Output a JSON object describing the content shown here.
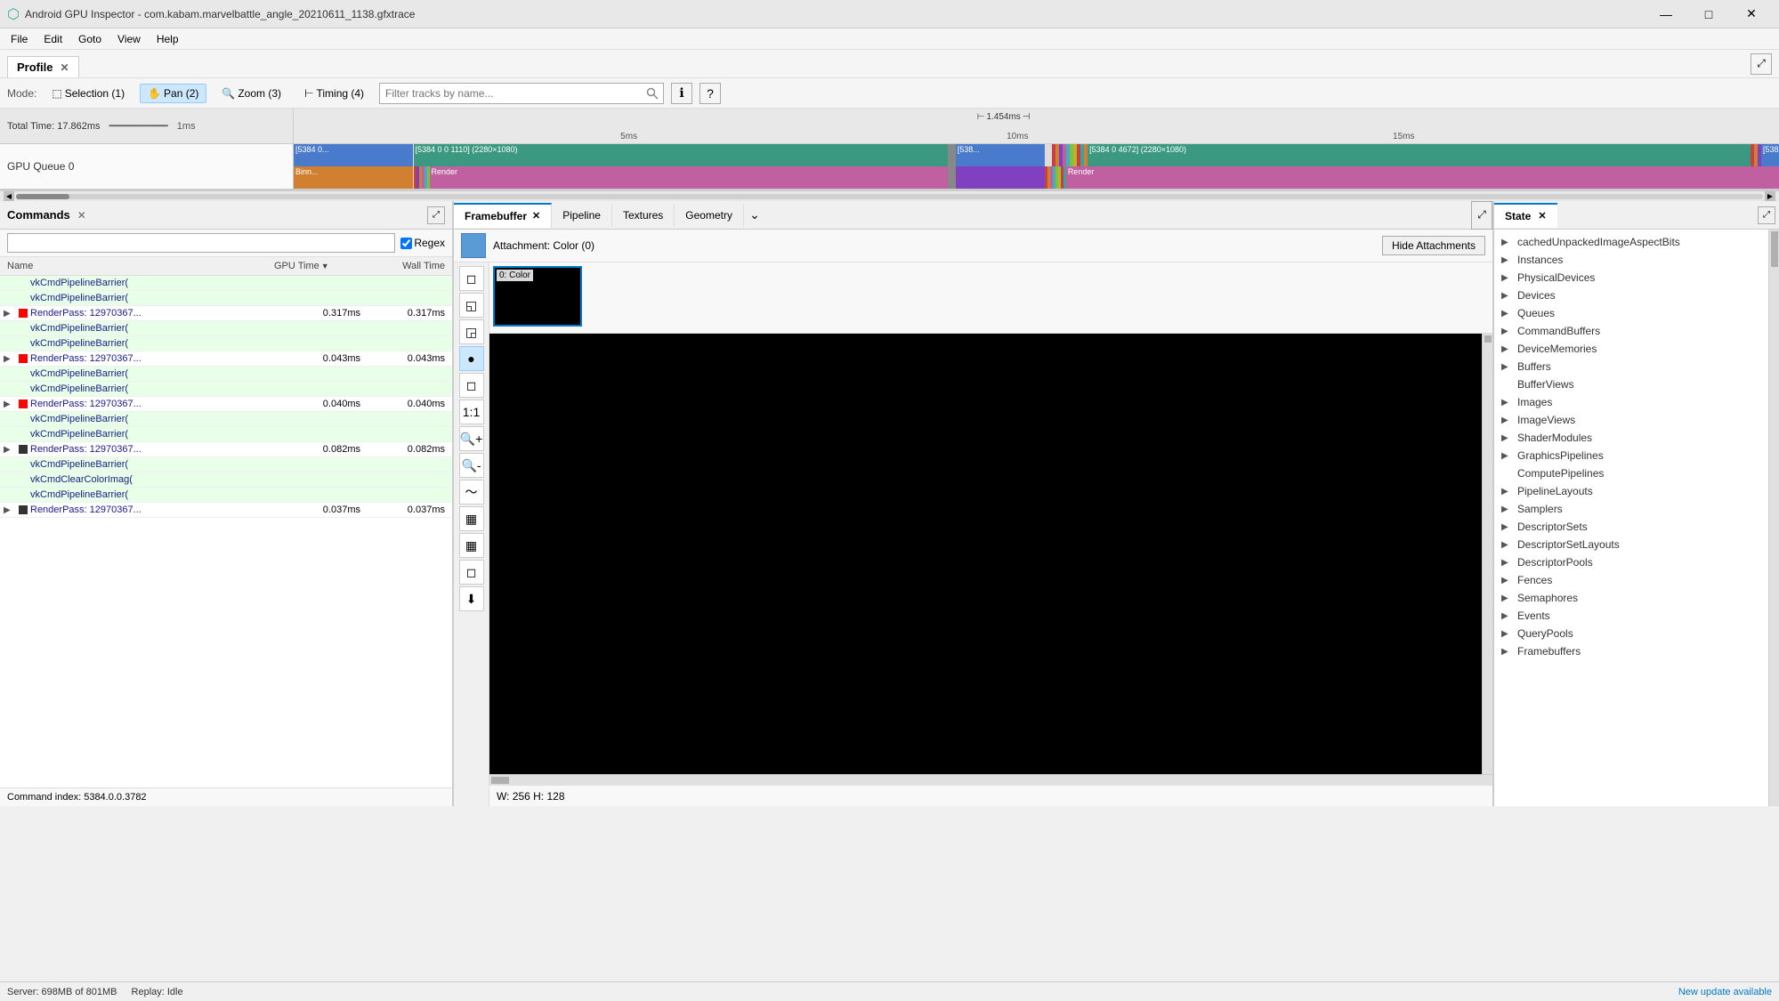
{
  "app": {
    "title": "Android GPU Inspector - com.kabam.marvelbattle_angle_20210611_1138.gfxtrace",
    "icon": "●"
  },
  "titlebar": {
    "minimize": "—",
    "maximize": "□",
    "close": "✕"
  },
  "menubar": {
    "items": [
      "File",
      "Edit",
      "Goto",
      "View",
      "Help"
    ]
  },
  "profile_tab": {
    "label": "Profile",
    "close": "✕"
  },
  "mode_toolbar": {
    "mode_label": "Mode:",
    "modes": [
      {
        "label": "Selection (1)",
        "icon": "⬚",
        "active": false
      },
      {
        "label": "Pan (2)",
        "icon": "✋",
        "active": true
      },
      {
        "label": "Zoom (3)",
        "icon": "🔍",
        "active": false
      },
      {
        "label": "Timing (4)",
        "icon": "⊢",
        "active": false
      }
    ],
    "filter_placeholder": "Filter tracks by name...",
    "info_btn": "ℹ",
    "help_btn": "?"
  },
  "timeline": {
    "total_time": "Total Time: 17.862ms",
    "scale": "1ms",
    "marks": [
      "5ms",
      "10ms",
      "15ms"
    ],
    "duration_indicator": "1.454ms",
    "duration_arrows": "⊢⊣"
  },
  "gpu_queue": {
    "label": "GPU Queue 0",
    "blocks_top": [
      {
        "text": "[5384 0...",
        "color": "blk-blue"
      },
      {
        "text": "[5384 0 0 1110] (2280×1080)",
        "color": "blk-teal"
      },
      {
        "text": "[538...",
        "color": "blk-blue"
      },
      {
        "text": "[5384 0 4672] (2280×1080)",
        "color": "blk-teal"
      },
      {
        "text": "[538...",
        "color": "blk-blue"
      }
    ],
    "blocks_bottom": [
      {
        "text": "Binn...",
        "color": "blk-orange"
      },
      {
        "text": "",
        "color": "blk-red"
      },
      {
        "text": "Render",
        "color": "blk-pink"
      },
      {
        "text": "",
        "color": "blk-red"
      },
      {
        "text": "Render",
        "color": "blk-pink"
      }
    ]
  },
  "commands_panel": {
    "title": "Commands",
    "close": "✕",
    "search_placeholder": "",
    "regex_label": "Regex",
    "columns": {
      "name": "Name",
      "gpu_time": "GPU Time",
      "wall_time": "Wall Time"
    },
    "rows": [
      {
        "indent": 1,
        "expand": false,
        "icon": "none",
        "name": "vkCmdPipelineBarrier(",
        "gpu_time": "",
        "wall_time": "",
        "green": true
      },
      {
        "indent": 1,
        "expand": false,
        "icon": "none",
        "name": "vkCmdPipelineBarrier(",
        "gpu_time": "",
        "wall_time": "",
        "green": true
      },
      {
        "indent": 1,
        "expand": true,
        "icon": "red",
        "name": "RenderPass: 12970367...",
        "gpu_time": "0.317ms",
        "wall_time": "0.317ms",
        "green": false
      },
      {
        "indent": 1,
        "expand": false,
        "icon": "none",
        "name": "vkCmdPipelineBarrier(",
        "gpu_time": "",
        "wall_time": "",
        "green": true
      },
      {
        "indent": 1,
        "expand": false,
        "icon": "none",
        "name": "vkCmdPipelineBarrier(",
        "gpu_time": "",
        "wall_time": "",
        "green": true
      },
      {
        "indent": 1,
        "expand": true,
        "icon": "red",
        "name": "RenderPass: 12970367...",
        "gpu_time": "0.043ms",
        "wall_time": "0.043ms",
        "green": false
      },
      {
        "indent": 1,
        "expand": false,
        "icon": "none",
        "name": "vkCmdPipelineBarrier(",
        "gpu_time": "",
        "wall_time": "",
        "green": true
      },
      {
        "indent": 1,
        "expand": false,
        "icon": "none",
        "name": "vkCmdPipelineBarrier(",
        "gpu_time": "",
        "wall_time": "",
        "green": true
      },
      {
        "indent": 1,
        "expand": true,
        "icon": "red",
        "name": "RenderPass: 12970367...",
        "gpu_time": "0.040ms",
        "wall_time": "0.040ms",
        "green": false
      },
      {
        "indent": 1,
        "expand": false,
        "icon": "none",
        "name": "vkCmdPipelineBarrier(",
        "gpu_time": "",
        "wall_time": "",
        "green": true
      },
      {
        "indent": 1,
        "expand": false,
        "icon": "none",
        "name": "vkCmdPipelineBarrier(",
        "gpu_time": "",
        "wall_time": "",
        "green": true
      },
      {
        "indent": 1,
        "expand": true,
        "icon": "dark",
        "name": "RenderPass: 12970367...",
        "gpu_time": "0.082ms",
        "wall_time": "0.082ms",
        "green": false
      },
      {
        "indent": 1,
        "expand": false,
        "icon": "none",
        "name": "vkCmdPipelineBarrier(",
        "gpu_time": "",
        "wall_time": "",
        "green": true
      },
      {
        "indent": 1,
        "expand": false,
        "icon": "none",
        "name": "vkCmdClearColorImag(",
        "gpu_time": "",
        "wall_time": "",
        "green": true
      },
      {
        "indent": 1,
        "expand": false,
        "icon": "none",
        "name": "vkCmdPipelineBarrier(",
        "gpu_time": "",
        "wall_time": "",
        "green": true
      },
      {
        "indent": 1,
        "expand": true,
        "icon": "dark",
        "name": "RenderPass: 12970367...",
        "gpu_time": "0.037ms",
        "wall_time": "0.037ms",
        "green": false
      }
    ],
    "command_index": "Command index: 5384.0.0.3782"
  },
  "framebuffer_panel": {
    "tabs": [
      "Framebuffer",
      "Pipeline",
      "Textures",
      "Geometry"
    ],
    "active_tab": "Framebuffer",
    "attachment_label": "Attachment: Color (0)",
    "hide_attachments_btn": "Hide Attachments",
    "tools": [
      "◻",
      "◱",
      "◲",
      "●",
      "◻2",
      "1:1",
      "🔍+",
      "🔍-",
      "〜",
      "▦",
      "▦2",
      "◻3",
      "⬇"
    ],
    "thumbnail": {
      "label": "0: Color",
      "bg": "#000"
    },
    "image_bg": "#000",
    "size_info": "W: 256 H: 128"
  },
  "state_panel": {
    "title": "State",
    "close": "✕",
    "items": [
      {
        "label": "cachedUnpackedImageAspectBits",
        "expandable": true
      },
      {
        "label": "Instances",
        "expandable": true
      },
      {
        "label": "PhysicalDevices",
        "expandable": true
      },
      {
        "label": "Devices",
        "expandable": true
      },
      {
        "label": "Queues",
        "expandable": true
      },
      {
        "label": "CommandBuffers",
        "expandable": true
      },
      {
        "label": "DeviceMemories",
        "expandable": true
      },
      {
        "label": "Buffers",
        "expandable": true
      },
      {
        "label": "BufferViews",
        "expandable": false
      },
      {
        "label": "Images",
        "expandable": true
      },
      {
        "label": "ImageViews",
        "expandable": true
      },
      {
        "label": "ShaderModules",
        "expandable": true
      },
      {
        "label": "GraphicsPipelines",
        "expandable": true
      },
      {
        "label": "ComputePipelines",
        "expandable": false
      },
      {
        "label": "PipelineLayouts",
        "expandable": true
      },
      {
        "label": "Samplers",
        "expandable": true
      },
      {
        "label": "DescriptorSets",
        "expandable": true
      },
      {
        "label": "DescriptorSetLayouts",
        "expandable": true
      },
      {
        "label": "DescriptorPools",
        "expandable": true
      },
      {
        "label": "Fences",
        "expandable": true
      },
      {
        "label": "Semaphores",
        "expandable": true
      },
      {
        "label": "Events",
        "expandable": true
      },
      {
        "label": "QueryPools",
        "expandable": true
      },
      {
        "label": "Framebuffers",
        "expandable": true
      }
    ]
  },
  "statusbar": {
    "server": "Server: 698MB of 801MB",
    "replay": "Replay: Idle",
    "update": "New update available"
  }
}
